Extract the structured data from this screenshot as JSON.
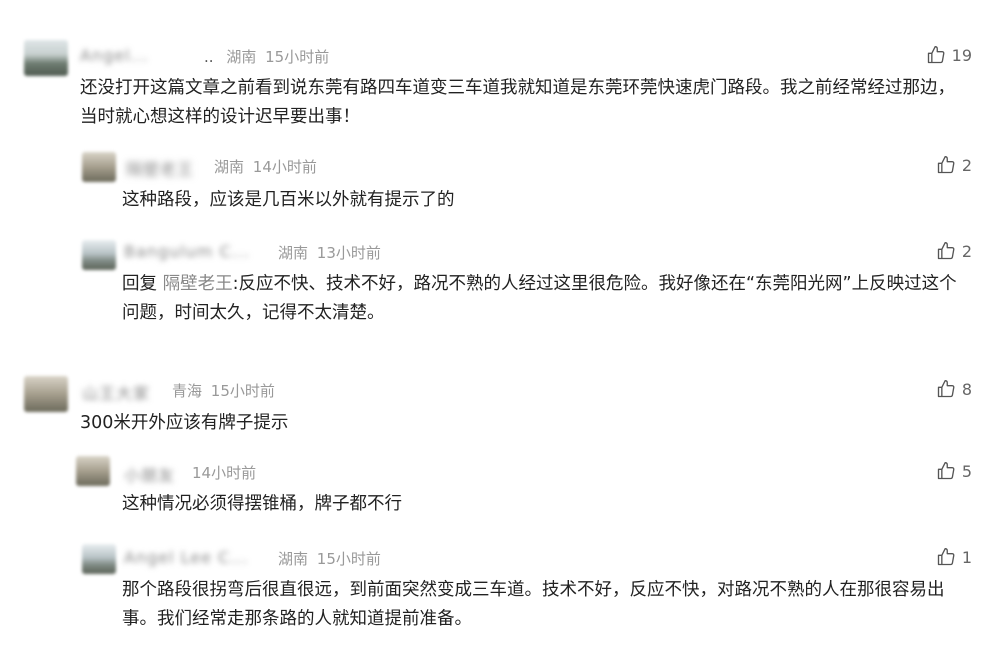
{
  "comments": [
    {
      "username": "Angel...",
      "username_suffix": "..",
      "location": "湖南",
      "time": "15小时前",
      "likes": "19",
      "text": "还没打开这篇文章之前看到说东莞有路四车道变三车道我就知道是东莞环莞快速虎门路段。我之前经常经过那边，当时就心想这样的设计迟早要出事！"
    },
    {
      "username": "隔壁老王",
      "location": "湖南",
      "time": "14小时前",
      "likes": "2",
      "text": "这种路段，应该是几百米以外就有提示了的"
    },
    {
      "username": "Bangulum C...",
      "location": "湖南",
      "time": "13小时前",
      "likes": "2",
      "reply_prefix": "回复",
      "reply_to": "隔壁老王",
      "text": ":反应不快、技术不好，路况不熟的人经过这里很危险。我好像还在“东莞阳光网”上反映过这个问题，时间太久，记得不太清楚。"
    },
    {
      "username": "山王大家",
      "location": "青海",
      "time": "15小时前",
      "likes": "8",
      "text": "300米开外应该有牌子提示"
    },
    {
      "username": "小朋友",
      "location": "",
      "time": "14小时前",
      "likes": "5",
      "text": "这种情况必须得摆锥桶，牌子都不行"
    },
    {
      "username": "Angel Lee C...",
      "location": "湖南",
      "time": "15小时前",
      "likes": "1",
      "text": "那个路段很拐弯后很直很远，到前面突然变成三车道。技术不好，反应不快，对路况不熟的人在那很容易出事。我们经常走那条路的人就知道提前准备。"
    }
  ]
}
